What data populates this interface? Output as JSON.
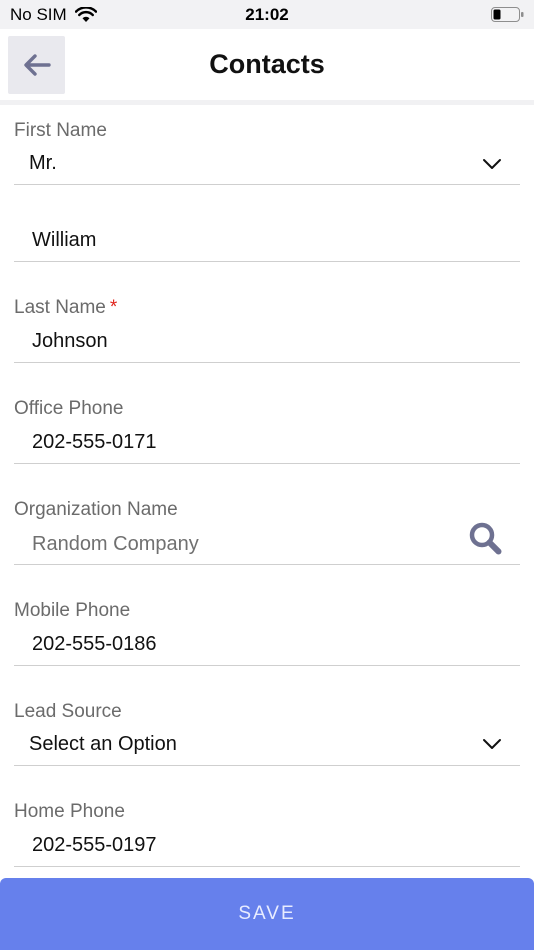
{
  "status_bar": {
    "carrier": "No SIM",
    "time": "21:02"
  },
  "header": {
    "title": "Contacts"
  },
  "form": {
    "salutation": {
      "label": "First Name",
      "value": "Mr."
    },
    "first_name": {
      "value": "William"
    },
    "last_name": {
      "label": "Last Name",
      "required_marker": "*",
      "value": "Johnson"
    },
    "office_phone": {
      "label": "Office Phone",
      "value": "202-555-0171"
    },
    "organization": {
      "label": "Organization Name",
      "placeholder": "Random Company"
    },
    "mobile_phone": {
      "label": "Mobile Phone",
      "value": "202-555-0186"
    },
    "lead_source": {
      "label": "Lead Source",
      "value": "Select an Option"
    },
    "home_phone": {
      "label": "Home Phone",
      "value": "202-555-0197"
    }
  },
  "footer": {
    "save_label": "SAVE"
  },
  "colors": {
    "accent": "#6680ec",
    "icon": "#6e7191",
    "required": "#e0251e"
  }
}
